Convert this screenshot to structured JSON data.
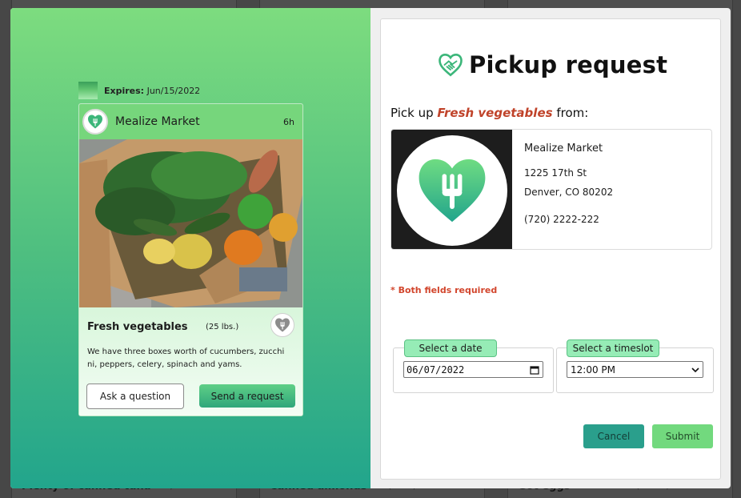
{
  "background": {
    "cards": [
      {
        "title": "Plenty of canned tuna",
        "weight": "(15 lbs.)"
      },
      {
        "title": "Canned almonds",
        "weight": "(5 lbs.)"
      },
      {
        "title": "Got eggs",
        "weight": "(12 lbs.)"
      }
    ]
  },
  "listing": {
    "expires_label": "Expires:",
    "expires_date": "Jun/15/2022",
    "store_name": "Mealize Market",
    "posted_ago": "6h",
    "photo_subject": "box of fresh vegetables",
    "title": "Fresh vegetables",
    "weight": "(25 lbs.)",
    "description": "We have three boxes worth of cucumbers, zucchini, peppers, celery, spinach and yams.",
    "ask_label": "Ask a question",
    "send_label": "Send a request"
  },
  "pickup": {
    "title": "Pickup request",
    "pick_up_prefix": "Pick up",
    "item": "Fresh vegetables",
    "pick_up_suffix": "from:",
    "store": {
      "name": "Mealize Market",
      "address1": "1225 17th St",
      "address2": "Denver, CO 80202",
      "phone": "(720) 2222-222"
    },
    "required_note": "* Both fields required",
    "date_label": "Select a date",
    "date_value": "06/07/2022",
    "timeslot_label": "Select a timeslot",
    "timeslot_value": "12:00 PM",
    "cancel_label": "Cancel",
    "submit_label": "Submit"
  },
  "colors": {
    "brand_green": "#76d67c",
    "teal": "#2a9f8c",
    "accent_red": "#c0432a"
  }
}
